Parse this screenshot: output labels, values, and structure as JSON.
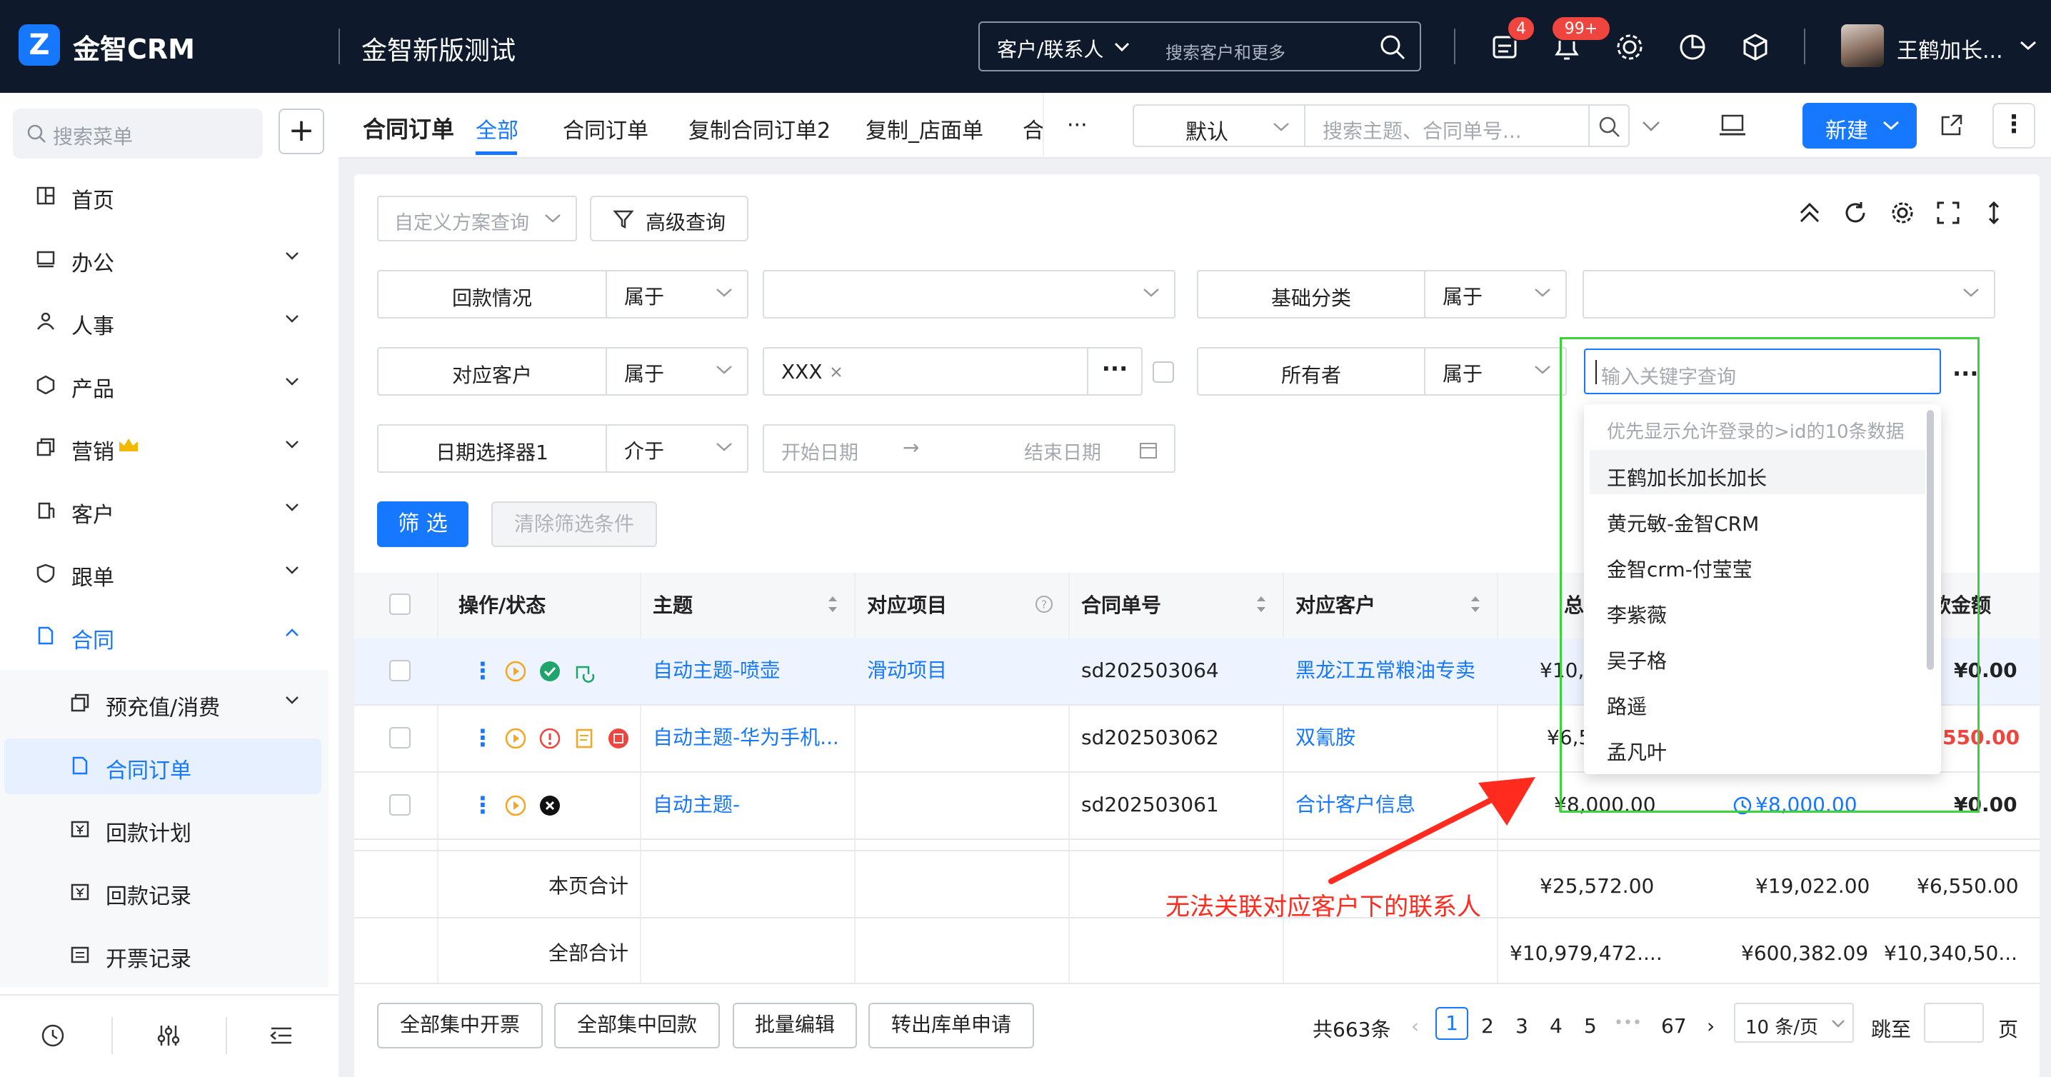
{
  "app": {
    "logo_mark": "Z",
    "name": "金智CRM",
    "system_title": "金智新版测试"
  },
  "global_search": {
    "scope": "客户/联系人",
    "placeholder": "搜索客户和更多"
  },
  "badges": {
    "tasks": "4",
    "notifications": "99+"
  },
  "user": {
    "name": "王鹤加长..."
  },
  "sidebar": {
    "search_placeholder": "搜索菜单",
    "items": [
      {
        "label": "首页"
      },
      {
        "label": "办公"
      },
      {
        "label": "人事"
      },
      {
        "label": "产品"
      },
      {
        "label": "营销"
      },
      {
        "label": "客户"
      },
      {
        "label": "跟单"
      },
      {
        "label": "合同"
      }
    ],
    "subitems": [
      {
        "label": "预充值/消费"
      },
      {
        "label": "合同订单"
      },
      {
        "label": "回款计划"
      },
      {
        "label": "回款记录"
      },
      {
        "label": "开票记录"
      }
    ]
  },
  "page": {
    "title": "合同订单",
    "tabs": [
      "全部",
      "合同订单",
      "复制合同订单2",
      "复制_店面单",
      "合",
      "···"
    ],
    "view_select": "默认",
    "search_placeholder": "搜索主题、合同单号...",
    "new_button": "新建"
  },
  "filters": {
    "custom_query_placeholder": "自定义方案查询",
    "advanced_query": "高级查询",
    "rows": [
      {
        "field": "回款情况",
        "op": "属于"
      },
      {
        "field": "基础分类",
        "op": "属于"
      },
      {
        "field": "对应客户",
        "op": "属于",
        "tag": "XXX"
      },
      {
        "field": "所有者",
        "op": "属于",
        "placeholder": "输入关键字查询"
      },
      {
        "field": "日期选择器1",
        "op": "介于",
        "start_placeholder": "开始日期",
        "arrow": "→",
        "end_placeholder": "结束日期"
      }
    ],
    "filter_button": "筛 选",
    "clear_button": "清除筛选条件"
  },
  "table": {
    "headers": [
      "操作/状态",
      "主题",
      "对应项目",
      "合同单号",
      "对应客户",
      "总",
      "款金额"
    ],
    "rows": [
      {
        "subject": "自动主题-喷壶",
        "project": "滑动项目",
        "number": "sd202503064",
        "customer": "黑龙江五常粮油专卖",
        "total": "¥10,0",
        "right_amount": "¥0.00"
      },
      {
        "subject": "自动主题-华为手机...",
        "project": "",
        "number": "sd202503062",
        "customer": "双氰胺",
        "total": "¥6,5",
        "right_amount": "550.00"
      },
      {
        "subject": "自动主题-",
        "project": "",
        "number": "sd202503061",
        "customer": "合计客户信息",
        "total": "¥8,000.00",
        "mid_amount": "¥8,000.00",
        "right_amount": "¥0.00"
      }
    ],
    "page_total": {
      "label": "本页合计",
      "c1": "¥25,572.00",
      "c2": "¥19,022.00",
      "c3": "¥6,550.00"
    },
    "all_total": {
      "label": "全部合计",
      "c1": "¥10,979,472....",
      "c2": "¥600,382.09",
      "c3": "¥10,340,50..."
    }
  },
  "dropdown": {
    "hint": "优先显示允许登录的>id的10条数据",
    "items": [
      "王鹤加长加长加长",
      "黄元敏-金智CRM",
      "金智crm-付莹莹",
      "李紫薇",
      "吴子格",
      "路遥",
      "孟凡叶"
    ]
  },
  "footer": {
    "buttons": [
      "全部集中开票",
      "全部集中回款",
      "批量编辑",
      "转出库单申请"
    ],
    "total": "共663条",
    "pages": [
      "1",
      "2",
      "3",
      "4",
      "5",
      "•••",
      "67"
    ],
    "page_size": "10 条/页",
    "jump_label": "跳至",
    "page_unit": "页"
  },
  "annotation": "无法关联对应客户下的联系人",
  "colors": {
    "primary": "#1677ff",
    "topbar": "#0e1a2b",
    "annotation": "#ff2b1f",
    "highlight_box": "#3ad43a",
    "danger": "#f0453f"
  }
}
